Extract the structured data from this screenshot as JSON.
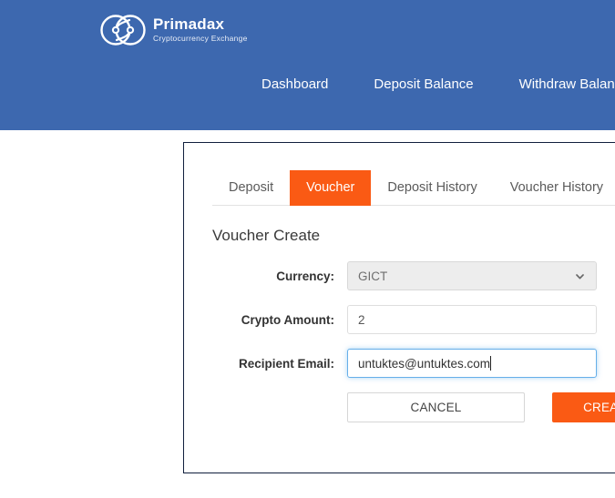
{
  "header": {
    "background_color": "#3d68af",
    "logo": {
      "icon": "interlocking-circles-logo-icon",
      "name": "Primadax",
      "tagline": "Cryptocurrency Exchange"
    },
    "nav": [
      {
        "label": "Dashboard",
        "name": "dashboard"
      },
      {
        "label": "Deposit Balance",
        "name": "deposit-balance"
      },
      {
        "label": "Withdraw Balance",
        "name": "withdraw-balance"
      }
    ]
  },
  "card": {
    "border_color": "#101f3d",
    "tabs": [
      {
        "label": "Deposit",
        "name": "deposit",
        "active": false
      },
      {
        "label": "Voucher",
        "name": "voucher",
        "active": true
      },
      {
        "label": "Deposit History",
        "name": "deposit-history",
        "active": false
      },
      {
        "label": "Voucher History",
        "name": "voucher-history",
        "active": false
      }
    ],
    "active_tab_color": "#fa5a14",
    "form": {
      "title": "Voucher Create",
      "currency": {
        "label": "Currency:",
        "value": "GICT",
        "disabled": true,
        "caret_icon": "chevron-down-icon"
      },
      "crypto_amount": {
        "label": "Crypto Amount:",
        "value": "2",
        "placeholder": ""
      },
      "recipient_email": {
        "label": "Recipient Email:",
        "value": "untuktes@untuktes.com",
        "placeholder": "",
        "focused": true,
        "focus_border_color": "#66afe9"
      },
      "actions": {
        "cancel_label": "CANCEL",
        "submit_label": "CREATE VOUCHER",
        "submit_color": "#fa5a14"
      }
    }
  }
}
